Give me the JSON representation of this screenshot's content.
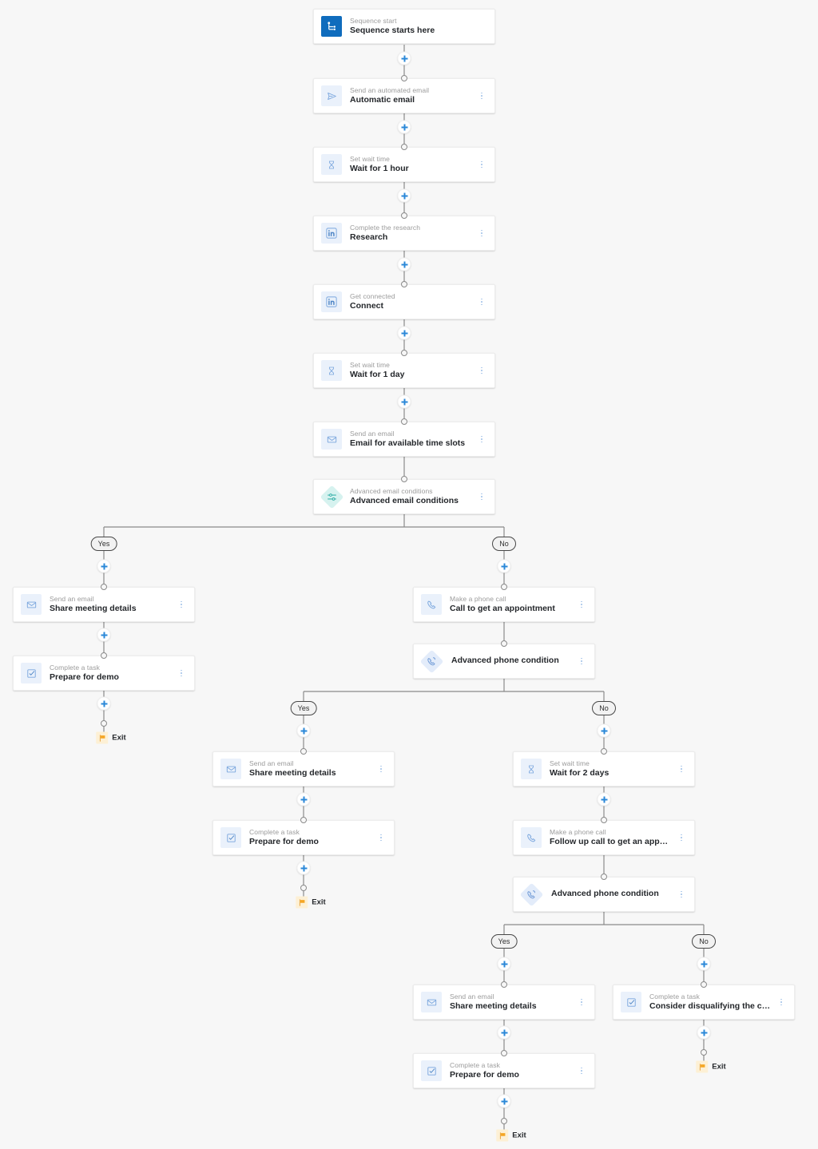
{
  "theme": {
    "canvas_bg": "#f7f7f7",
    "card_bg": "#ffffff",
    "accent_blue": "#2b88d8",
    "brand_blue": "#0f6cbd",
    "condition_teal": "#d6f2ef",
    "condition_blue": "#e3ecfa",
    "exit_orange": "#f0a30a",
    "connector_gray": "#8a8a8a"
  },
  "labels": {
    "yes": "Yes",
    "no": "No",
    "exit": "Exit",
    "add": "+"
  },
  "nodes": {
    "sequence_start": {
      "subtitle": "Sequence start",
      "title": "Sequence starts here",
      "icon": "sequence-start-icon"
    },
    "automatic_email": {
      "subtitle": "Send an automated email",
      "title": "Automatic email",
      "icon": "paper-plane-icon"
    },
    "wait_1_hour": {
      "subtitle": "Set wait time",
      "title": "Wait for 1 hour",
      "icon": "hourglass-icon"
    },
    "research": {
      "subtitle": "Complete the research",
      "title": "Research",
      "icon": "linkedin-icon"
    },
    "connect": {
      "subtitle": "Get connected",
      "title": "Connect",
      "icon": "linkedin-icon"
    },
    "wait_1_day": {
      "subtitle": "Set wait time",
      "title": "Wait for 1 day",
      "icon": "hourglass-icon"
    },
    "email_time_slots": {
      "subtitle": "Send an email",
      "title": "Email for available time slots",
      "icon": "envelope-icon"
    },
    "advanced_email_conditions": {
      "subtitle": "Advanced email conditions",
      "title": "Advanced email conditions",
      "icon": "sliders-diamond-icon"
    },
    "share_meeting_details_a": {
      "subtitle": "Send an email",
      "title": "Share meeting details",
      "icon": "envelope-icon"
    },
    "prepare_for_demo_a": {
      "subtitle": "Complete a task",
      "title": "Prepare for demo",
      "icon": "checkbox-task-icon"
    },
    "call_appointment": {
      "subtitle": "Make a phone call",
      "title": "Call to get an appointment",
      "icon": "phone-icon"
    },
    "advanced_phone_condition_1": {
      "subtitle": "",
      "title": "Advanced phone condition",
      "icon": "phone-diamond-icon"
    },
    "share_meeting_details_b": {
      "subtitle": "Send an email",
      "title": "Share meeting details",
      "icon": "envelope-icon"
    },
    "prepare_for_demo_b": {
      "subtitle": "Complete a task",
      "title": "Prepare for demo",
      "icon": "checkbox-task-icon"
    },
    "wait_2_days": {
      "subtitle": "Set wait time",
      "title": "Wait for 2 days",
      "icon": "hourglass-icon"
    },
    "follow_up_call": {
      "subtitle": "Make a phone call",
      "title": "Follow up call to get an appointment",
      "icon": "phone-icon"
    },
    "advanced_phone_condition_2": {
      "subtitle": "",
      "title": "Advanced phone condition",
      "icon": "phone-diamond-icon"
    },
    "share_meeting_details_c": {
      "subtitle": "Send an email",
      "title": "Share meeting details",
      "icon": "envelope-icon"
    },
    "prepare_for_demo_c": {
      "subtitle": "Complete a task",
      "title": "Prepare for demo",
      "icon": "checkbox-task-icon"
    },
    "disqualify_customer": {
      "subtitle": "Complete a task",
      "title": "Consider disqualifying the customer",
      "icon": "checkbox-task-icon"
    }
  },
  "branches": {
    "email_condition": {
      "yes": "Yes",
      "no": "No"
    },
    "phone_condition_1": {
      "yes": "Yes",
      "no": "No"
    },
    "phone_condition_2": {
      "yes": "Yes",
      "no": "No"
    }
  },
  "exits": {
    "exit_1": "Exit",
    "exit_2": "Exit",
    "exit_3": "Exit",
    "exit_4": "Exit"
  }
}
